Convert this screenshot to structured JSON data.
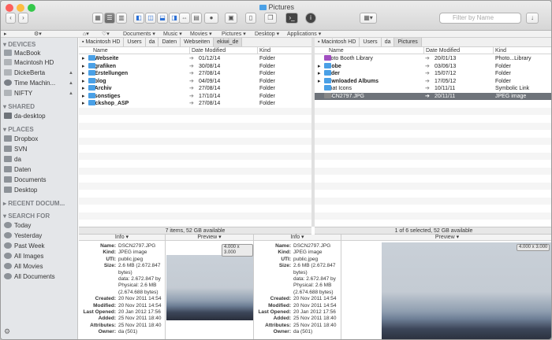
{
  "window": {
    "title": "Pictures"
  },
  "toolbar": {
    "search_placeholder": "Filter by Name"
  },
  "favorites": [
    "Documents",
    "Music",
    "Movies",
    "Pictures",
    "Desktop",
    "Applications"
  ],
  "sidebar": {
    "devices_header": "DEVICES",
    "devices": [
      {
        "label": "MacBook",
        "eject": false
      },
      {
        "label": "Macintosh HD",
        "eject": false
      },
      {
        "label": "DickeBerta",
        "eject": true
      },
      {
        "label": "Time Machin...",
        "eject": true
      },
      {
        "label": "NIFTY",
        "eject": true
      }
    ],
    "shared_header": "SHARED",
    "shared": [
      {
        "label": "da-desktop"
      }
    ],
    "places_header": "PLACES",
    "places": [
      {
        "label": "Dropbox"
      },
      {
        "label": "SVN"
      },
      {
        "label": "da"
      },
      {
        "label": "Daten"
      },
      {
        "label": "Documents"
      },
      {
        "label": "Desktop"
      }
    ],
    "recent_header": "RECENT DOCUM...",
    "search_header": "SEARCH FOR",
    "search": [
      {
        "label": "Today"
      },
      {
        "label": "Yesterday"
      },
      {
        "label": "Past Week"
      },
      {
        "label": "All Images"
      },
      {
        "label": "All Movies"
      },
      {
        "label": "All Documents"
      }
    ]
  },
  "left_pane": {
    "path": [
      "Macintosh HD",
      "Users",
      "da",
      "Daten",
      "Webseiten",
      "ekiwi_de"
    ],
    "columns": {
      "name": "Name",
      "date": "Date Modified",
      "kind": "Kind"
    },
    "rows": [
      {
        "name": "1_Webseite",
        "date": "01/12/14",
        "kind": "Folder"
      },
      {
        "name": "2_grafiken",
        "date": "30/08/14",
        "kind": "Folder"
      },
      {
        "name": "3_Erstellungen",
        "date": "27/08/14",
        "kind": "Folder"
      },
      {
        "name": "4_blog",
        "date": "04/09/14",
        "kind": "Folder"
      },
      {
        "name": "5_Archiv",
        "date": "27/08/14",
        "kind": "Folder"
      },
      {
        "name": "6_sonstiges",
        "date": "17/10/14",
        "kind": "Folder"
      },
      {
        "name": "Packshop_ASP",
        "date": "27/08/14",
        "kind": "Folder"
      }
    ],
    "status": "7 items, 52 GB available"
  },
  "right_pane": {
    "path": [
      "Macintosh HD",
      "Users",
      "da",
      "Pictures"
    ],
    "columns": {
      "name": "Name",
      "date": "Date Modified",
      "kind": "Kind"
    },
    "rows": [
      {
        "name": "Photo Booth Library",
        "date": "20/01/13",
        "kind": "Photo...Library",
        "icon": "#a04ec0"
      },
      {
        "name": "Adobe",
        "date": "03/06/13",
        "kind": "Folder",
        "icon": "#4aa0e6"
      },
      {
        "name": "Bilder",
        "date": "15/07/12",
        "kind": "Folder",
        "icon": "#4aa0e6"
      },
      {
        "name": "Downloaded Albums",
        "date": "17/05/12",
        "kind": "Folder",
        "icon": "#4aa0e6"
      },
      {
        "name": "iChat Icons",
        "date": "10/11/11",
        "kind": "Symbolic Link",
        "icon": "#4aa0e6"
      },
      {
        "name": "DSCN2797.JPG",
        "date": "20/11/11",
        "kind": "JPEG image",
        "icon": "#888888"
      }
    ],
    "status": "1 of 6 selected, 52 GB available"
  },
  "info": {
    "header": "Info",
    "preview_header": "Preview",
    "dimensions": "4.000 x 3.000",
    "fields": [
      {
        "k": "Name:",
        "v": "DSCN2797.JPG"
      },
      {
        "k": "Kind:",
        "v": "JPEG image"
      },
      {
        "k": "UTI:",
        "v": "public.jpeg"
      },
      {
        "k": "Size:",
        "v": "2.6 MB (2.672.847"
      },
      {
        "k": "",
        "v": "bytes)"
      },
      {
        "k": "",
        "v": "data: 2.672.847 by"
      },
      {
        "k": "",
        "v": "Physical: 2.6 MB"
      },
      {
        "k": "",
        "v": "(2.674.688 bytes)"
      },
      {
        "k": "Created:",
        "v": "20 Nov 2011 14:54"
      },
      {
        "k": "Modified:",
        "v": "20 Nov 2011 14:54"
      },
      {
        "k": "Last Opened:",
        "v": "20 Jan 2012 17:56"
      },
      {
        "k": "Added:",
        "v": "25 Nov 2011 18:40"
      },
      {
        "k": "Attributes:",
        "v": "25 Nov 2011 18:40"
      },
      {
        "k": "Owner:",
        "v": "da (501)"
      }
    ]
  }
}
